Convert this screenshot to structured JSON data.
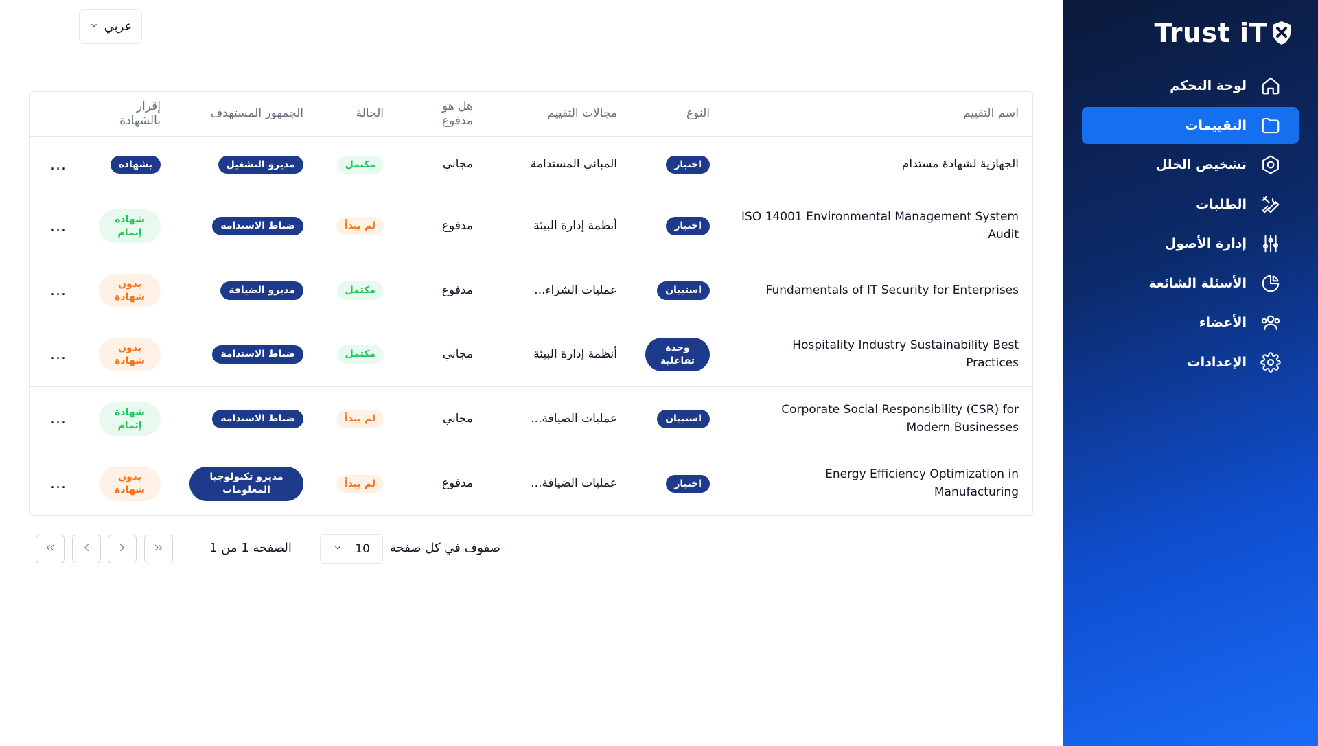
{
  "header": {
    "language_label": "عربي"
  },
  "sidebar": {
    "brand": "Trust iT",
    "items": [
      {
        "label": "لوحة التحكم",
        "icon": "home-icon",
        "active": false
      },
      {
        "label": "التقييمات",
        "icon": "folder-icon",
        "active": true
      },
      {
        "label": "تشخيص الخلل",
        "icon": "hexagon-settings-icon",
        "active": false
      },
      {
        "label": "الطلبات",
        "icon": "tools-icon",
        "active": false
      },
      {
        "label": "إدارة الأصول",
        "icon": "sliders-icon",
        "active": false
      },
      {
        "label": "الأسئلة الشائعة",
        "icon": "pie-chart-icon",
        "active": false
      },
      {
        "label": "الأعضاء",
        "icon": "users-icon",
        "active": false
      },
      {
        "label": "الإعدادات",
        "icon": "gear-icon",
        "active": false
      }
    ]
  },
  "table": {
    "columns": {
      "name": "اسم التقييم",
      "type": "النوع",
      "domains": "مجالات التقييم",
      "paid": "هل هو مدفوع",
      "status": "الحالة",
      "audience": "الجمهور المستهدف",
      "certificate": "إقرار بالشهادة"
    },
    "rows": [
      {
        "name": "الجهازية لشهادة مستدام",
        "type": "اختبار",
        "domains": "المباني المستدامة",
        "paid": "مجاني",
        "status": "مكتمل",
        "audience": "مديرو التشغيل",
        "certificate": "بشهادة"
      },
      {
        "name": "ISO 14001 Environmental Management System Audit",
        "type": "اختبار",
        "domains": "أنظمة إدارة البيئة",
        "paid": "مدفوع",
        "status": "لم يبدأ",
        "audience": "ضباط الاستدامة",
        "certificate": "شهادة إتمام"
      },
      {
        "name": "Fundamentals of IT Security for Enterprises",
        "type": "استبيان",
        "domains": "عمليات الشراء...",
        "paid": "مدفوع",
        "status": "مكتمل",
        "audience": "مديرو الضيافة",
        "certificate": "بدون شهادة"
      },
      {
        "name": "Hospitality Industry Sustainability Best Practices",
        "type": "وحدة تفاعلية",
        "domains": "أنظمة إدارة البيئة",
        "paid": "مجاني",
        "status": "مكتمل",
        "audience": "ضباط الاستدامة",
        "certificate": "بدون شهادة"
      },
      {
        "name": "Corporate Social Responsibility (CSR) for Modern Businesses",
        "type": "استبيان",
        "domains": "عمليات الضيافة...",
        "paid": "مجاني",
        "status": "لم يبدأ",
        "audience": "ضباط الاستدامة",
        "certificate": "شهادة إتمام"
      },
      {
        "name": "Energy Efficiency Optimization in Manufacturing",
        "type": "اختبار",
        "domains": "عمليات الضيافة...",
        "paid": "مدفوع",
        "status": "لم يبدأ",
        "audience": "مديرو تكنولوجيا المعلومات",
        "certificate": "بدون شهادة"
      }
    ],
    "actions_label": "..."
  },
  "pagination": {
    "rows_per_page_label": "صفوف في كل صفحة",
    "rows_per_page_value": "10",
    "page_label": "الصفحة 1 من 1"
  },
  "colors": {
    "sidebar_dark": "#0b1a3a",
    "sidebar_light": "#1a6cf5",
    "active_item": "#1570ef",
    "pill_navy": "#1e3a8a",
    "status_complete": "#22c55e",
    "status_pending": "#f97316"
  }
}
